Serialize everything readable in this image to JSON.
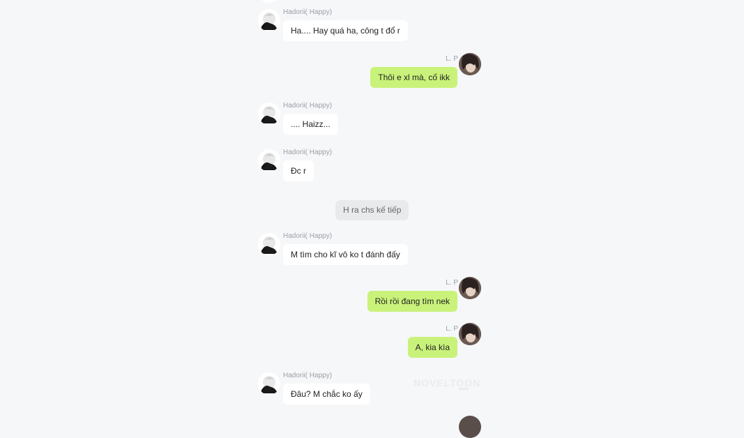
{
  "chat": {
    "watermark": "NOVELTOON",
    "system_note": "H ra chs kế tiếp",
    "messages": [
      {
        "side": "left",
        "sender": "Hadorii( Happy)",
        "text": "Ha.... Hay quá ha, công t đổ r"
      },
      {
        "side": "right",
        "sender": "L. P",
        "text": "Thôi e xl mà, cố ikk"
      },
      {
        "side": "left",
        "sender": "Hadorii( Happy)",
        "text": ".... Haizz..."
      },
      {
        "side": "left",
        "sender": "Hadorii( Happy)",
        "text": "Đc r"
      },
      {
        "side": "left",
        "sender": "Hadorii( Happy)",
        "text": "M tìm cho kĩ vô ko t đánh đấy"
      },
      {
        "side": "right",
        "sender": "L. P",
        "text": "Rồi rồi đang tìm nek"
      },
      {
        "side": "right",
        "sender": "L. P",
        "text": "A, kia kìa"
      },
      {
        "side": "left",
        "sender": "Hadorii( Happy)",
        "text": "Đâu? M chắc ko ấy"
      }
    ]
  },
  "colors": {
    "background": "#f6f7f9",
    "left_bubble": "#ffffff",
    "right_bubble": "#c9f27a",
    "system_bubble": "#e9eaec",
    "sender_name": "#9aa0a6"
  }
}
